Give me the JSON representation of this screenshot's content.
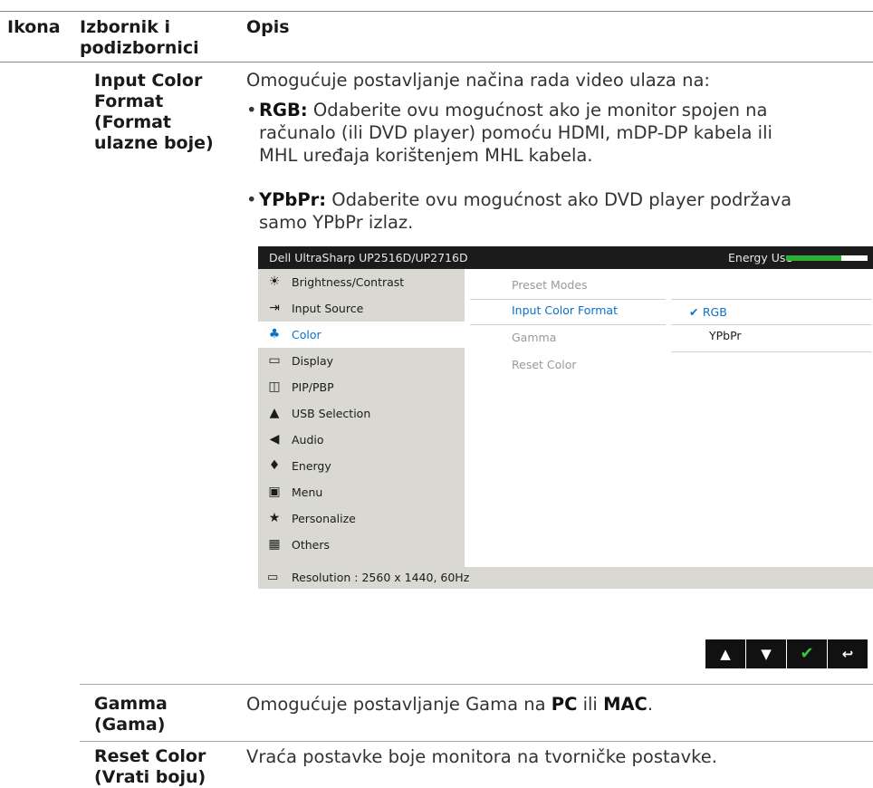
{
  "table": {
    "headers": {
      "icon": "Ikona",
      "menu_l1": "Izbornik i",
      "menu_l2": "podizbornici",
      "desc": "Opis"
    }
  },
  "input_color": {
    "sub_l1": "Input Color",
    "sub_l2": "Format",
    "sub_l3": "(Format",
    "sub_l4": "ulazne boje)",
    "intro": "Omogućuje postavljanje načina rada video ulaza na:",
    "rgb_term": "RGB:",
    "rgb_l1": "Odaberite ovu mogućnost ako je monitor spojen na",
    "rgb_l2": "računalo (ili DVD player) pomoću HDMI, mDP-DP kabela ili",
    "rgb_l3": "MHL uređaja korištenjem MHL kabela.",
    "ypbpr_term": "YPbPr:",
    "ypbpr_l1": "Odaberite ovu mogućnost ako DVD player podržava",
    "ypbpr_l2": "samo YPbPr izlaz."
  },
  "osd": {
    "title": "Dell UltraSharp UP2516D/UP2716D",
    "energy_label": "Energy Use",
    "energy_level": 0.68,
    "menu": [
      {
        "label": "Brightness/Contrast",
        "icon": "brightness-icon"
      },
      {
        "label": "Input Source",
        "icon": "input-source-icon"
      },
      {
        "label": "Color",
        "icon": "color-icon"
      },
      {
        "label": "Display",
        "icon": "display-icon"
      },
      {
        "label": "PIP/PBP",
        "icon": "pip-icon"
      },
      {
        "label": "USB Selection",
        "icon": "usb-icon"
      },
      {
        "label": "Audio",
        "icon": "audio-icon"
      },
      {
        "label": "Energy",
        "icon": "energy-icon"
      },
      {
        "label": "Menu",
        "icon": "menu-icon"
      },
      {
        "label": "Personalize",
        "icon": "star-icon"
      },
      {
        "label": "Others",
        "icon": "others-icon"
      }
    ],
    "submenu": {
      "preset_modes": "Preset Modes",
      "input_color_format": "Input Color Format",
      "gamma": "Gamma",
      "reset_color": "Reset Color"
    },
    "options": {
      "rgb": "RGB",
      "ypbpr": "YPbPr"
    },
    "footer": "Resolution : 2560 x 1440, 60Hz",
    "accent": "#0a72c7"
  },
  "nav_buttons": [
    "up-icon",
    "down-icon",
    "check-icon",
    "back-icon"
  ],
  "gamma_row": {
    "sub_l1": "Gamma",
    "sub_l2": "(Gama)",
    "desc_pre": "Omogućuje postavljanje Gama na",
    "pc": "PC",
    "or": "ili",
    "mac": "MAC",
    "period": "."
  },
  "reset_row": {
    "sub_l1": "Reset Color",
    "sub_l2": "(Vrati boju)",
    "desc": "Vraća postavke boje monitora na tvorničke postavke."
  }
}
